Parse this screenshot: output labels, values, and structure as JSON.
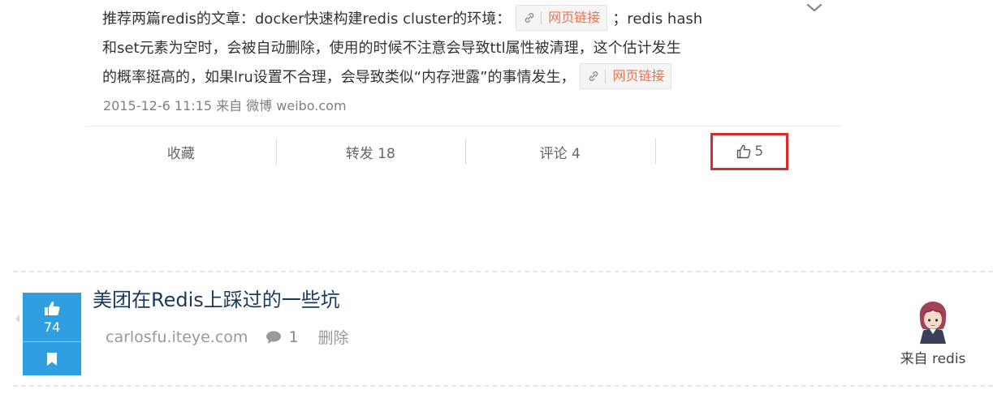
{
  "post": {
    "text_line1": "推荐两篇redis的文章：docker快速构建redis cluster的环境：",
    "link1_label": "网页链接",
    "text_line1_tail": "；redis hash",
    "text_line2": "和set元素为空时，会被自动删除，使用的时候不注意会导致ttl属性被清理，这个估计发生",
    "text_line3": "的概率挺高的，如果lru设置不合理，会导致类似“内存泄露”的事情发生，",
    "link2_label": "网页链接",
    "meta": "2015-12-6 11:15 来自 微博 weibo.com"
  },
  "actions": {
    "favorite": "收藏",
    "repost": "转发 18",
    "comment": "评论 4",
    "like_count": "5"
  },
  "article": {
    "votes": "74",
    "title": "美团在Redis上踩过的一些坑",
    "domain": "carlosfu.iteye.com",
    "comment_count": "1",
    "delete_label": "删除",
    "source_label": "来自 redis"
  },
  "colors": {
    "accent_blue": "#2f9fe0",
    "link_orange": "#eb7350",
    "highlight_red": "#d92b2b",
    "title_navy": "#1a3a5e"
  },
  "icons": [
    "link-icon",
    "chevron-down-icon",
    "thumbs-up-icon",
    "bookmark-icon",
    "comment-bubble-icon",
    "avatar-image"
  ]
}
